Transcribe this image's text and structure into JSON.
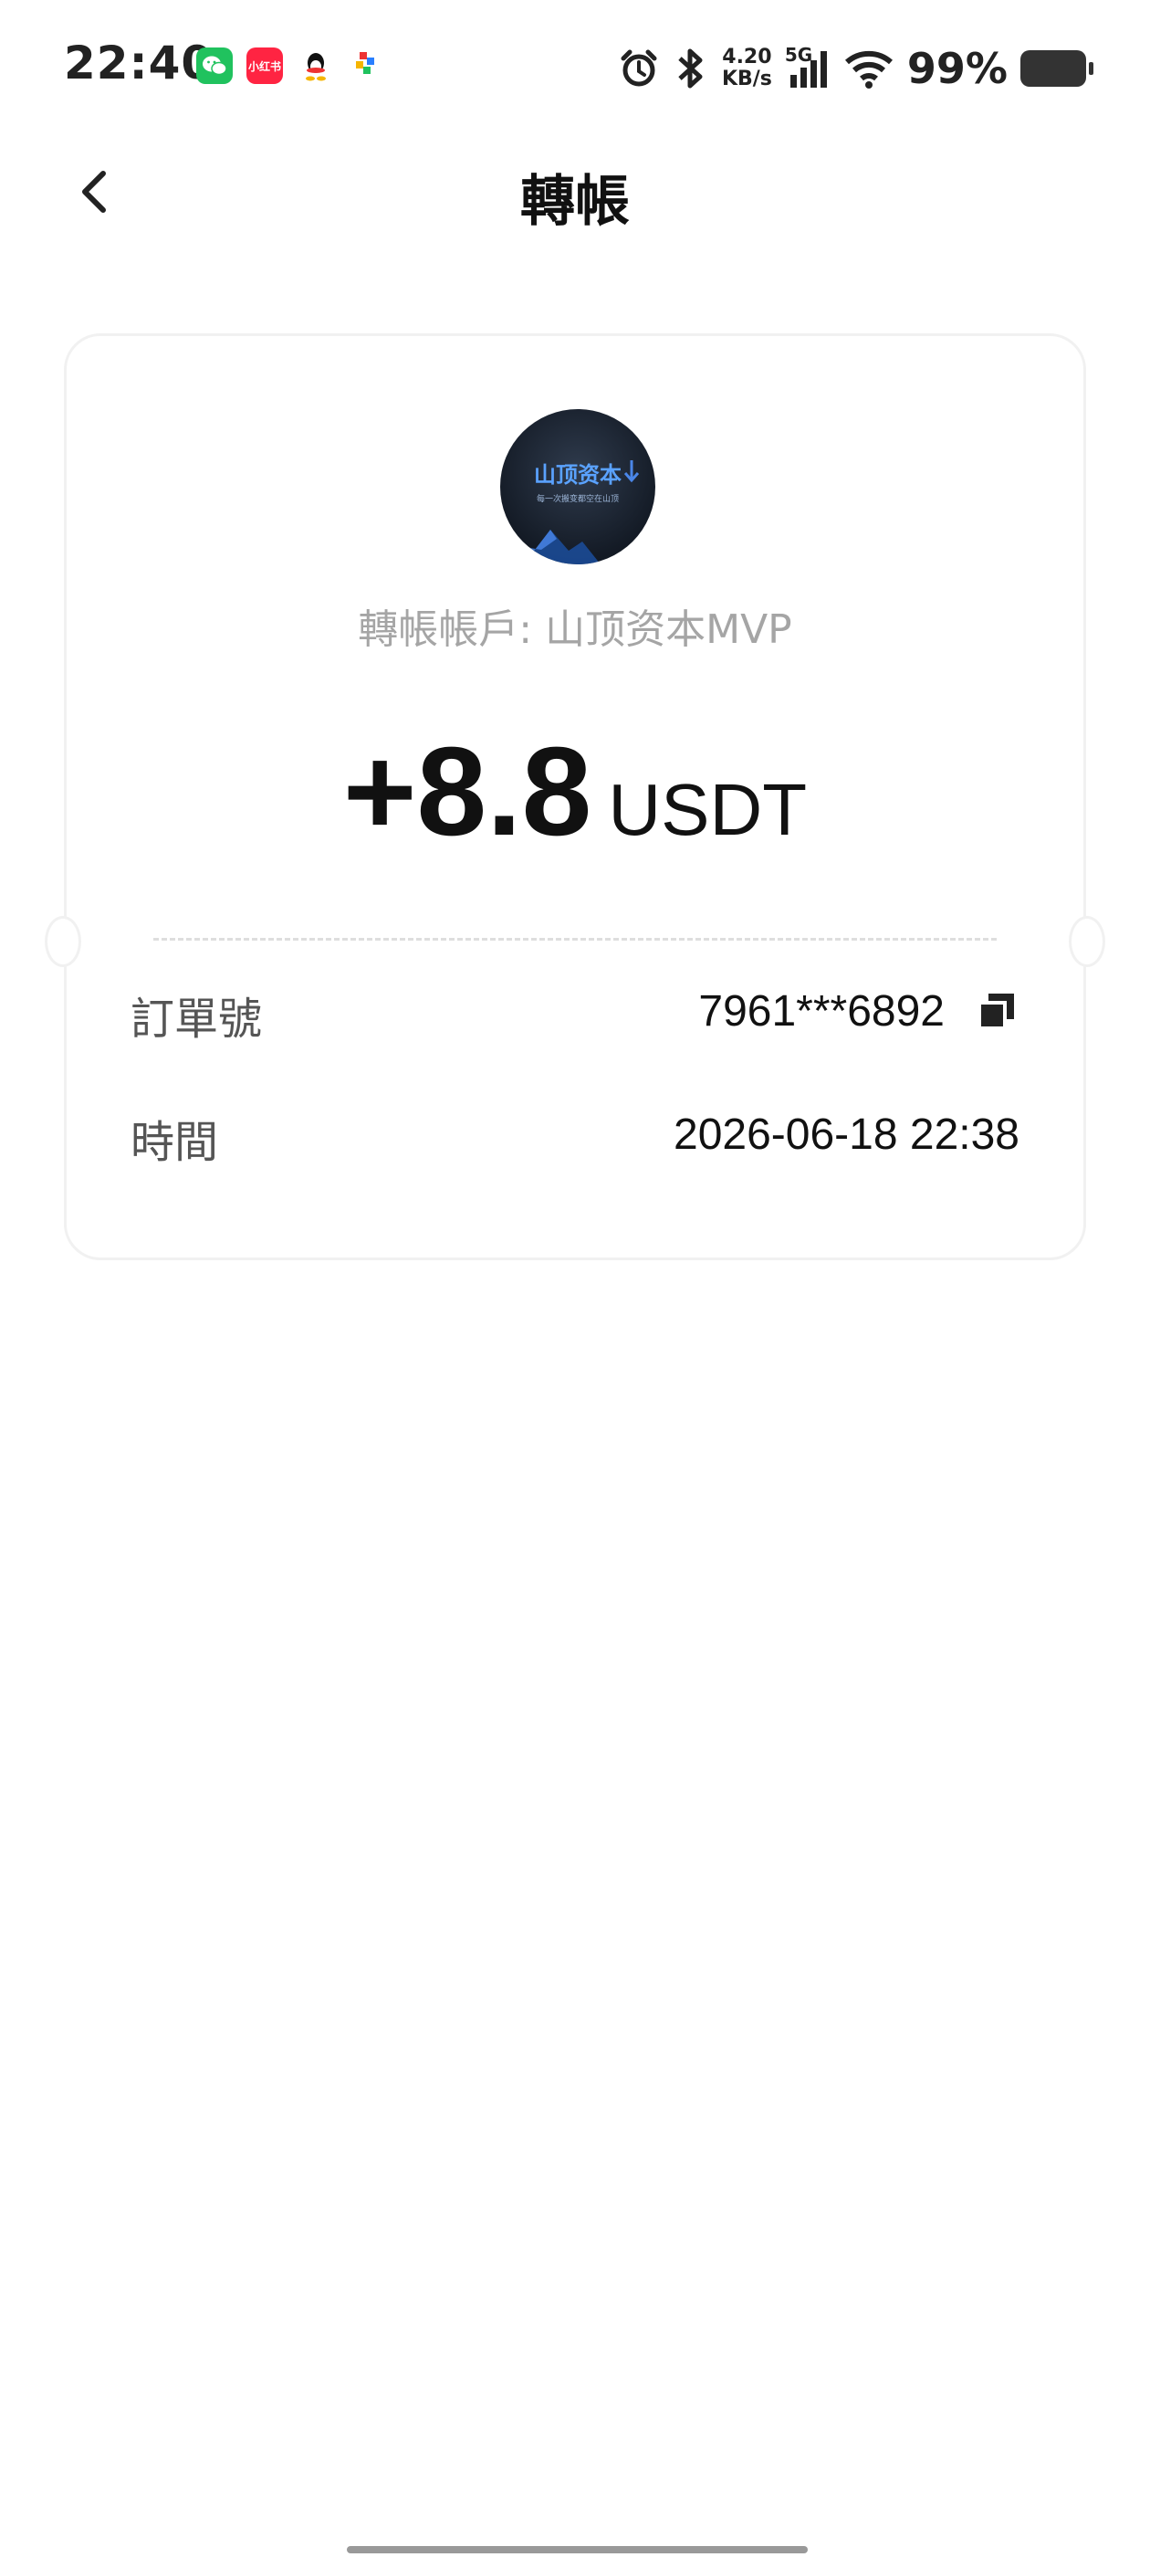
{
  "status_bar": {
    "time": "22:40",
    "notification_icons": [
      "wechat-icon",
      "xiaohongshu-icon",
      "qq-icon",
      "pinwheel-icon"
    ],
    "xiaohongshu_label": "小红书",
    "net_speed_value": "4.20",
    "net_speed_unit": "KB/s",
    "network_type": "5G",
    "battery_percent": "99%",
    "battery_level": 0.99
  },
  "header": {
    "title": "轉帳"
  },
  "card": {
    "avatar": {
      "name": "山顶资本",
      "tagline": "每一次搬变都空在山顶"
    },
    "account_label": "轉帳帳戶: 山顶资本MVP",
    "amount": "+8.8",
    "currency": "USDT",
    "rows": [
      {
        "label": "訂單號",
        "value": "7961***6892"
      },
      {
        "label": "時間",
        "value": "2026-06-18 22:38"
      }
    ]
  },
  "colors": {
    "background": "#ffffff",
    "card_border": "#f1f1f1",
    "muted_text": "#a5a5a5",
    "primary_text": "#111111",
    "avatar_accent": "#5aa2ff"
  }
}
